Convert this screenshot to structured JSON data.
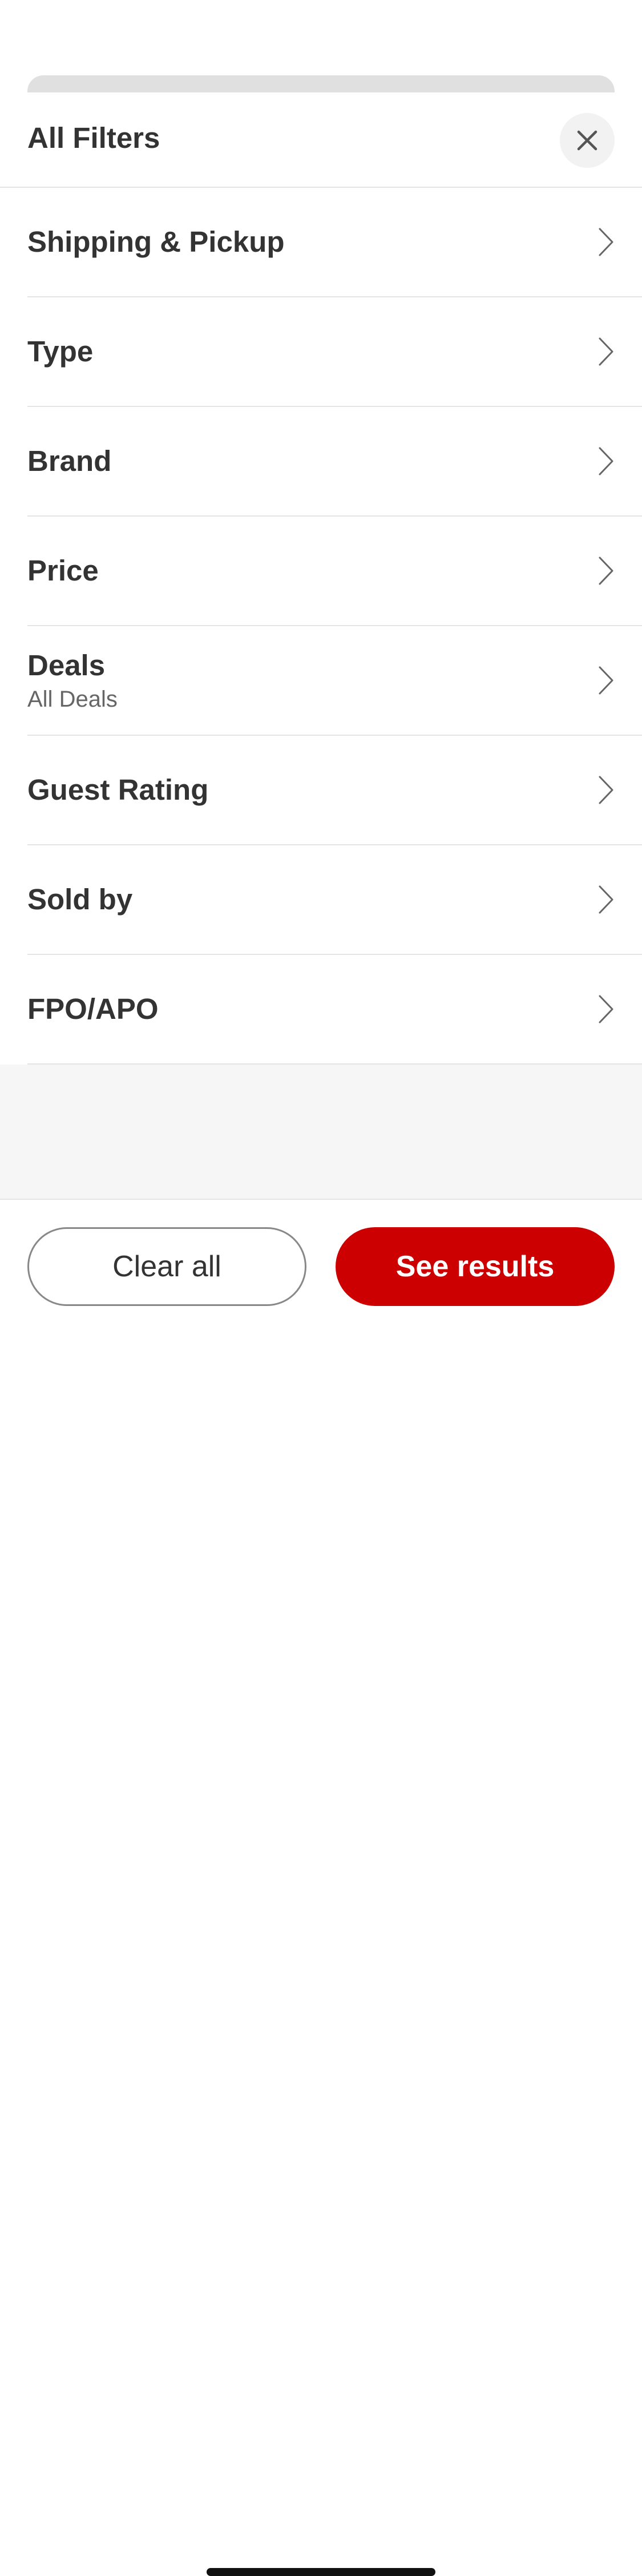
{
  "header": {
    "title": "All Filters",
    "close_icon": "close-icon"
  },
  "filters": [
    {
      "label": "Shipping & Pickup",
      "sub": ""
    },
    {
      "label": "Type",
      "sub": ""
    },
    {
      "label": "Brand",
      "sub": ""
    },
    {
      "label": "Price",
      "sub": ""
    },
    {
      "label": "Deals",
      "sub": "All Deals"
    },
    {
      "label": "Guest Rating",
      "sub": ""
    },
    {
      "label": "Sold by",
      "sub": ""
    },
    {
      "label": "FPO/APO",
      "sub": ""
    }
  ],
  "footer": {
    "clear_label": "Clear all",
    "results_label": "See results"
  },
  "colors": {
    "accent": "#cc0000",
    "text": "#333333",
    "divider": "#e4e4e4"
  }
}
